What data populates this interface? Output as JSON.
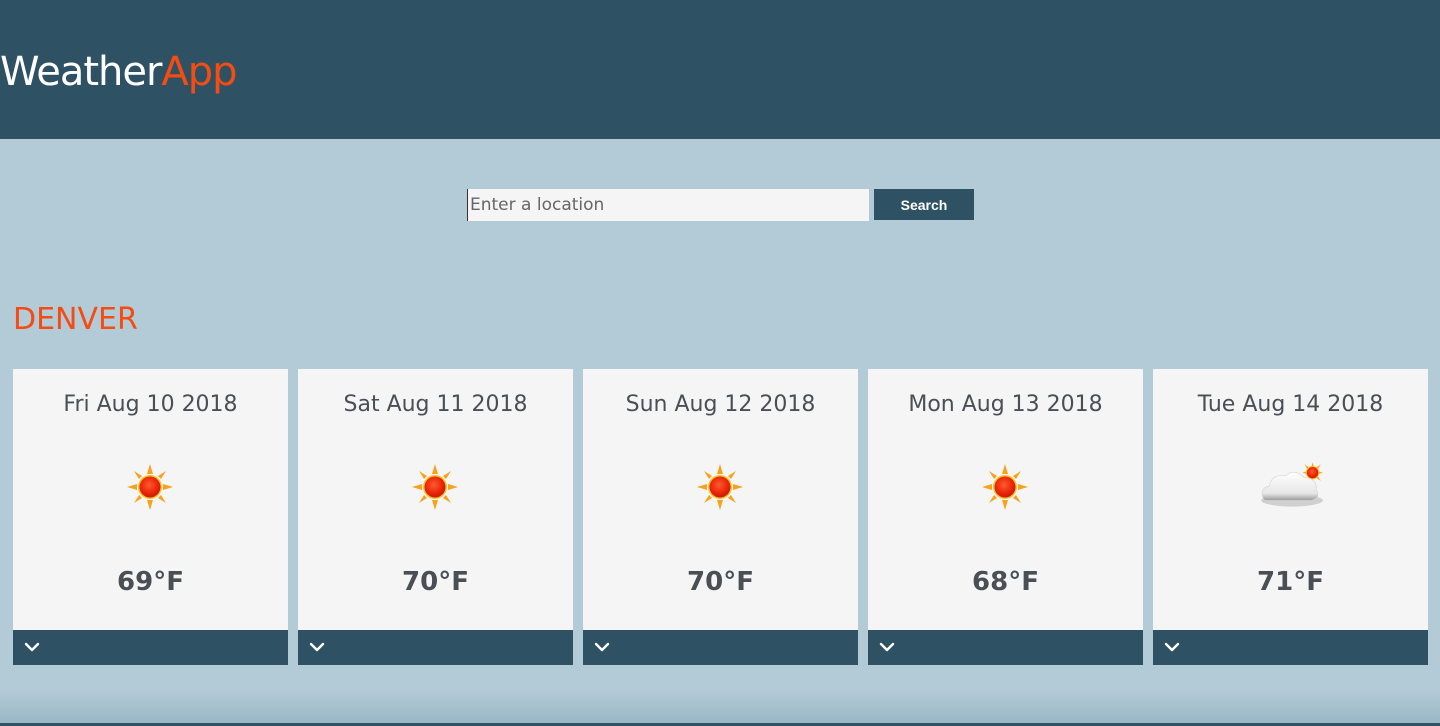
{
  "header": {
    "logo_primary": "Weather",
    "logo_accent": "App"
  },
  "search": {
    "placeholder": "Enter a location",
    "value": "",
    "button_label": "Search"
  },
  "location": {
    "city": "DENVER"
  },
  "forecast": [
    {
      "date": "Fri Aug 10 2018",
      "temp": "69°F",
      "icon": "sunny-icon"
    },
    {
      "date": "Sat Aug 11 2018",
      "temp": "70°F",
      "icon": "sunny-icon"
    },
    {
      "date": "Sun Aug 12 2018",
      "temp": "70°F",
      "icon": "sunny-icon"
    },
    {
      "date": "Mon Aug 13 2018",
      "temp": "68°F",
      "icon": "sunny-icon"
    },
    {
      "date": "Tue Aug 14 2018",
      "temp": "71°F",
      "icon": "partly-cloudy-icon"
    }
  ],
  "colors": {
    "header_bg": "#2e5164",
    "page_bg": "#b2cbd7",
    "accent": "#f44c12",
    "card_bg": "#f5f5f5",
    "text": "#4a4f55"
  }
}
